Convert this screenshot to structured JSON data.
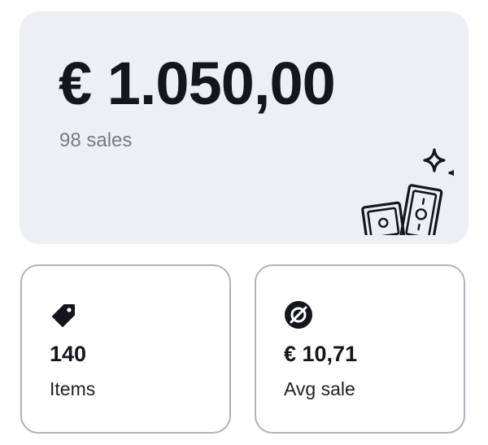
{
  "summary": {
    "total_amount": "€ 1.050,00",
    "sales_count": "98 sales",
    "illustration_icon": "money-bills-sparkles-icon"
  },
  "stats": {
    "items": {
      "icon": "price-tag-icon",
      "value": "140",
      "label": "Items"
    },
    "avg_sale": {
      "icon": "average-diameter-icon",
      "value": "€ 10,71",
      "label": "Avg sale"
    }
  },
  "colors": {
    "hero_background": "#eeeff4",
    "card_border": "#aeb3ba",
    "text_primary": "#14161c",
    "text_muted": "#777b85"
  }
}
